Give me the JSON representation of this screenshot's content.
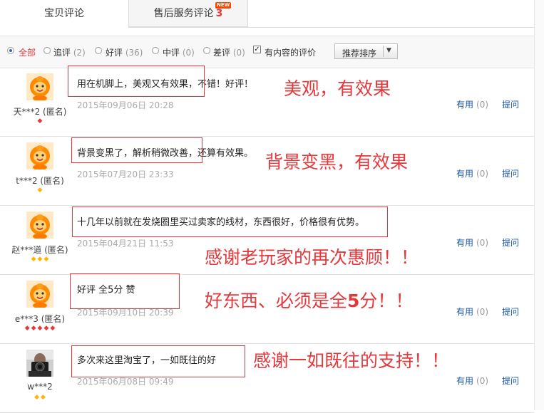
{
  "tabs": {
    "main_label": "宝贝评论",
    "after_label": "售后服务评论",
    "after_count": "3",
    "new_badge": "NEW"
  },
  "filters": {
    "all": "全部",
    "append": "追评",
    "append_count": "(2)",
    "good": "好评",
    "good_count": "(36)",
    "medium": "中评",
    "medium_count": "(0)",
    "bad": "差评",
    "bad_count": "(0)",
    "with_content": "有内容的评价",
    "sort_label": "推荐排序",
    "selected": "all",
    "with_content_checked": true
  },
  "reviews": [
    {
      "user": "天***2 (匿名)",
      "comment": "用在机脚上，美观又有效果，不错！好评！",
      "date": "2015年09月06日 20:28",
      "useful_label": "有用",
      "useful_count": "(0)",
      "ask_label": "提问",
      "note": "美观，有效果",
      "badge_type": "red",
      "badge_count": 1
    },
    {
      "user": "t***2 (匿名)",
      "comment": "背景变黑了，解析稍微改善，还算有效果。",
      "date": "2015年07月20日 23:33",
      "useful_label": "有用",
      "useful_count": "(0)",
      "ask_label": "提问",
      "note": "背景变黑，有效果",
      "badge_type": "gold",
      "badge_count": 1
    },
    {
      "user": "赵***道 (匿名)",
      "comment": "十几年以前就在发烧圈里买过卖家的线材，东西很好，价格很有优势。",
      "date": "2015年04月21日 11:53",
      "useful_label": "有用",
      "useful_count": "(0)",
      "ask_label": "提问",
      "note": "感谢老玩家的再次惠顾！！",
      "badge_type": "gold",
      "badge_count": 3
    },
    {
      "user": "e***3 (匿名)",
      "comment": "好评 全5分 赞",
      "date": "2015年09月10日 20:39",
      "useful_label": "有用",
      "useful_count": "(0)",
      "ask_label": "提问",
      "note_prefix": "好东西、必须是全",
      "note_bold": "5",
      "note_suffix": "分！！",
      "badge_type": "red",
      "badge_count": 5
    },
    {
      "user": "w***2",
      "comment": "多次来这里淘宝了，一如既往的好",
      "date": "2015年06月08日 09:49",
      "useful_label": "有用",
      "useful_count": "(0)",
      "ask_label": "提问",
      "note": "感谢一如既往的支持！！",
      "badge_type": "gold",
      "badge_count": 2
    }
  ],
  "colors": {
    "accent_red": "#e4393c",
    "link_blue": "#1a56a8",
    "gold": "#ffb400"
  }
}
